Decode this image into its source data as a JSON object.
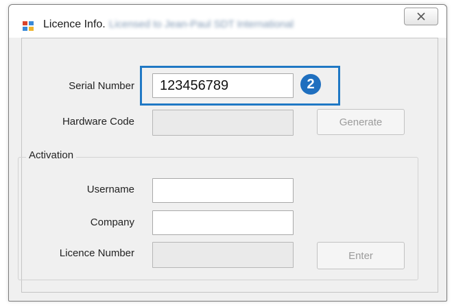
{
  "window": {
    "title": "Licence Info.",
    "subtitle": "Licensed to Jean-Paul SDT International"
  },
  "form": {
    "serial_label": "Serial Number",
    "serial_value": "123456789",
    "badge": "2",
    "hardware_label": "Hardware Code",
    "hardware_value": "",
    "generate_label": "Generate"
  },
  "activation": {
    "group_label": "Activation",
    "username_label": "Username",
    "username_value": "",
    "company_label": "Company",
    "company_value": "",
    "licence_label": "Licence Number",
    "licence_value": "",
    "enter_label": "Enter"
  },
  "colors": {
    "highlight": "#1f78c4",
    "badge": "#1f6fbf",
    "window_bg": "#f0f0f0"
  },
  "icons": {
    "app": "app-window-icon",
    "close": "close-icon"
  }
}
